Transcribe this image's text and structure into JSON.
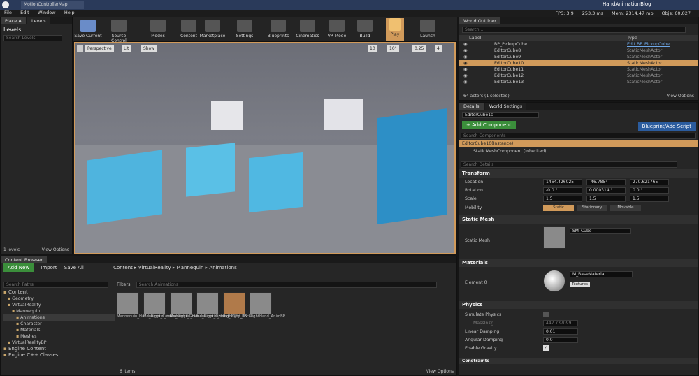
{
  "window": {
    "title": "MotionControllerMap",
    "blog": "HandAnimationBlog",
    "stats": [
      "FPS: 3.9",
      "253.3 ms",
      "Mem: 2314.47 mb",
      "Objs: 60,027"
    ]
  },
  "menu": [
    "File",
    "Edit",
    "Window",
    "Help"
  ],
  "modes_panel": {
    "tabs": [
      "Place A",
      "Levels"
    ],
    "title": "Levels",
    "search_placeholder": "Search Levels",
    "footer_count": "1 levels",
    "view_options": "View Options"
  },
  "toolbar": {
    "buttons": [
      "Save Current",
      "Source Control",
      "Modes",
      "Content",
      "Marketplace",
      "Settings",
      "Blueprints",
      "Cinematics",
      "VR Mode",
      "Build",
      "Play",
      "Launch"
    ]
  },
  "viewport": {
    "perspective": "Perspective",
    "lit": "Lit",
    "show": "Show",
    "grid": "10",
    "angle": "10°",
    "scale": "0.25",
    "camera": "4"
  },
  "outliner": {
    "tab": "World Outliner",
    "search_placeholder": "Search...",
    "col_label": "Label",
    "col_type": "Type",
    "rows": [
      {
        "label": "BP_PickupCube",
        "type": "Edit BP_PickupCube",
        "selected": false
      },
      {
        "label": "EditorCube8",
        "type": "StaticMeshActor",
        "selected": false
      },
      {
        "label": "EditorCube9",
        "type": "StaticMeshActor",
        "selected": false
      },
      {
        "label": "EditorCube10",
        "type": "StaticMeshActor",
        "selected": true
      },
      {
        "label": "EditorCube11",
        "type": "StaticMeshActor",
        "selected": false
      },
      {
        "label": "EditorCube12",
        "type": "StaticMeshActor",
        "selected": false
      },
      {
        "label": "EditorCube13",
        "type": "StaticMeshActor",
        "selected": false
      }
    ],
    "footer": "64 actors (1 selected)",
    "view_options": "View Options"
  },
  "details": {
    "tabs": [
      "Details",
      "World Settings"
    ],
    "name": "EditorCube10",
    "add_component": "+ Add Component",
    "blueprint_script": "Blueprint/Add Script",
    "search_components": "Search Components",
    "instance": "EditorCube10(Instance)",
    "component": "StaticMeshComponent (Inherited)",
    "search_details": "Search Details",
    "transform_header": "Transform",
    "location_label": "Location",
    "rotation_label": "Rotation",
    "scale_label": "Scale",
    "mobility_label": "Mobility",
    "location": [
      "1464.426025",
      "-46.7854",
      "270.621765"
    ],
    "rotation": [
      "-0.0 °",
      "0.000314 °",
      "0.0 °"
    ],
    "scale": [
      "1.5",
      "1.5",
      "1.5"
    ],
    "mobility": [
      "Static",
      "Stationary",
      "Movable"
    ],
    "static_mesh_header": "Static Mesh",
    "static_mesh_label": "Static Mesh",
    "static_mesh_value": "SM_Cube",
    "materials_header": "Materials",
    "element_label": "Element 0",
    "material_value": "M_BaseMaterial",
    "textures": "Textures",
    "physics_header": "Physics",
    "simulate_physics": "Simulate Physics",
    "mass_kg": "MassInKg",
    "mass_value": "442.737099",
    "linear_damping": "Linear Damping",
    "linear_value": "0.01",
    "angular_damping": "Angular Damping",
    "angular_value": "0.0",
    "enable_gravity": "Enable Gravity",
    "constraints": "Constraints"
  },
  "content_browser": {
    "tab": "Content Browser",
    "add_new": "Add New",
    "import": "Import",
    "save_all": "Save All",
    "breadcrumb": [
      "Content",
      "VirtualReality",
      "Mannequin",
      "Animations"
    ],
    "search_paths": "Search Paths",
    "filters": "Filters",
    "search_animations": "Search Animations",
    "tree": [
      {
        "label": "Content",
        "indent": 0
      },
      {
        "label": "Geometry",
        "indent": 1
      },
      {
        "label": "VirtualReality",
        "indent": 1
      },
      {
        "label": "Mannequin",
        "indent": 2
      },
      {
        "label": "Animations",
        "indent": 3
      },
      {
        "label": "Character",
        "indent": 3
      },
      {
        "label": "Materials",
        "indent": 3
      },
      {
        "label": "Meshes",
        "indent": 3
      },
      {
        "label": "VirtualRealityBP",
        "indent": 1
      },
      {
        "label": "Engine Content",
        "indent": 0
      },
      {
        "label": "Engine C++ Classes",
        "indent": 0
      }
    ],
    "assets": [
      {
        "label": "Mannequin_Hand_Right_CanGrab"
      },
      {
        "label": "Mannequin_Hand_Right_Grab"
      },
      {
        "label": "Mannequin_Hand_Right_Open"
      },
      {
        "label": "Mannequin_Hand_Right_Rock"
      },
      {
        "label": "RightGrip_BS"
      },
      {
        "label": "RightHand_AnimBP"
      }
    ],
    "items_count": "6 items",
    "view_options": "View Options"
  },
  "colors": {
    "accent_orange": "#d19a5a",
    "selection": "#d19a5a",
    "add_green": "#3b8e3b",
    "blueprint_blue": "#2b5c9e"
  }
}
